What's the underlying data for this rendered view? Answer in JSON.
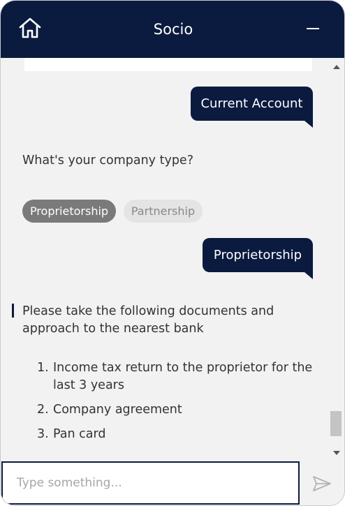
{
  "header": {
    "title": "Socio",
    "home_icon": "home-icon",
    "minimize_icon": "minimize-icon"
  },
  "messages": {
    "user_1": "Current Account",
    "bot_question": "What's your company type?",
    "options": [
      {
        "label": "Proprietorship",
        "selected": true
      },
      {
        "label": "Partnership",
        "selected": false
      }
    ],
    "user_2": "Proprietorship",
    "bot_docs_line1": "Please take the following documents and",
    "bot_docs_line2": "approach to the nearest bank",
    "documents": [
      {
        "num": "1.",
        "line1": "Income tax return to the proprietor for the",
        "line2": "last 3 years"
      },
      {
        "num": "2.",
        "line1": "Company agreement",
        "line2": ""
      },
      {
        "num": "3.",
        "line1": "Pan card",
        "line2": ""
      }
    ]
  },
  "composer": {
    "placeholder": "Type something...",
    "value": "",
    "send_icon": "send-icon"
  },
  "colors": {
    "primary": "#0b1b3f",
    "chip_selected": "#7a7a7a",
    "chip_unselected": "#e4e4e4",
    "background": "#f2f2f2"
  }
}
